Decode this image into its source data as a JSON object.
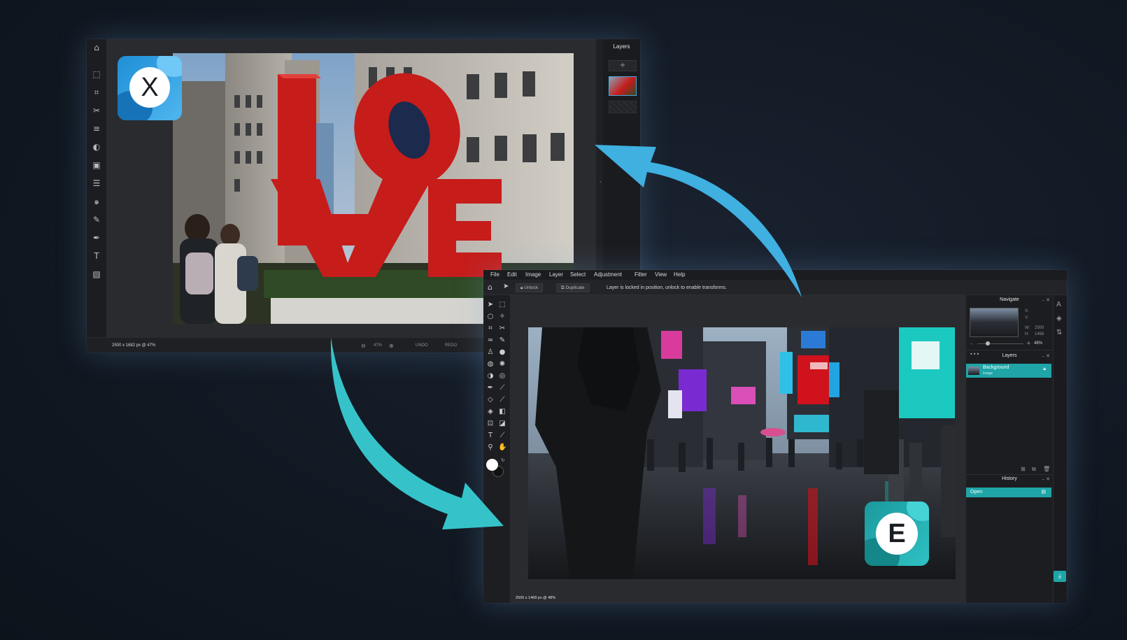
{
  "colors": {
    "background": "#121923",
    "teal_accent": "#1fa5a8",
    "arrow_blue": "#3fb0e0",
    "arrow_teal": "#35c3c9"
  },
  "left_editor": {
    "layers_title": "Layers",
    "status": "2500 x 1682 px @ 47%",
    "zoom": "47%",
    "undo_label": "UNDO",
    "redo_label": "REDO",
    "logo_letter": "X"
  },
  "right_editor": {
    "menu": [
      "File",
      "Edit",
      "Image",
      "Layer",
      "Select",
      "Adjustment",
      "Filter",
      "View",
      "Help"
    ],
    "unlock_label": "Unlock",
    "duplicate_label": "Duplicate",
    "lock_message": "Layer is locked in position, unlock to enable transforms.",
    "navigate": {
      "title": "Navigate",
      "x_label": "X:",
      "y_label": "Y:",
      "w_label": "W:",
      "w_value": "2500",
      "h_label": "H:",
      "h_value": "1468",
      "zoom": "48%"
    },
    "layers": {
      "title": "Layers",
      "layer_name": "Background",
      "layer_type": "Image"
    },
    "history": {
      "title": "History",
      "entry": "Open"
    },
    "status": "2500 x 1468 px @ 48%",
    "logo_letter": "E"
  }
}
